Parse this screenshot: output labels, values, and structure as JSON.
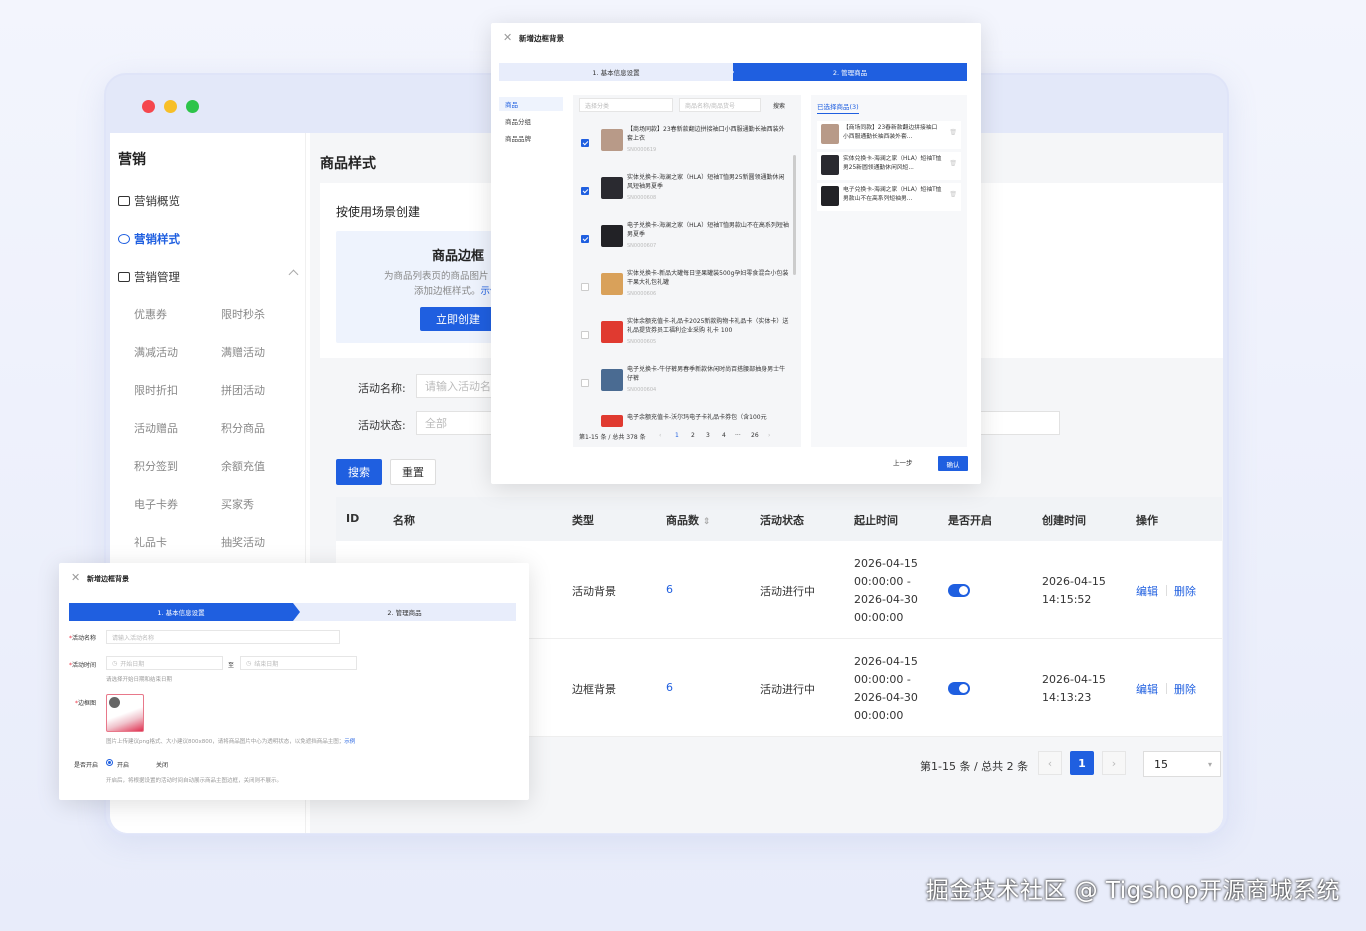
{
  "watermark": "掘金技术社区 @ Tigshop开源商城系统",
  "colors": {
    "accent": "#1f5fe0",
    "dot_red": "#f5474e",
    "dot_yellow": "#f7bf28",
    "dot_green": "#2dc44a"
  },
  "sidebar": {
    "title": "营销",
    "items": [
      {
        "label": "营销概览",
        "icon": "dashboard-icon"
      },
      {
        "label": "营销样式",
        "icon": "palette-icon"
      },
      {
        "label": "营销管理",
        "icon": "manage-icon"
      }
    ],
    "sub_items": [
      "优惠券",
      "限时秒杀",
      "满减活动",
      "满赠活动",
      "限时折扣",
      "拼团活动",
      "活动赠品",
      "积分商品",
      "积分签到",
      "余额充值",
      "电子卡券",
      "买家秀",
      "礼品卡",
      "抽奖活动"
    ]
  },
  "main": {
    "page_title": "商品样式",
    "scene_label": "按使用场景创建",
    "scene_card": {
      "title": "商品边框",
      "desc1": "为商品列表页的商品图片",
      "desc2": "添加边框样式。",
      "link": "示例",
      "button": "立即创建"
    },
    "filters": {
      "name_label": "活动名称:",
      "name_placeholder": "请输入活动名",
      "status_label": "活动状态:",
      "status_value": "全部"
    },
    "search_button": "搜索",
    "reset_button": "重置"
  },
  "table": {
    "headers": [
      "ID",
      "名称",
      "类型",
      "商品数",
      "活动状态",
      "起止时间",
      "是否开启",
      "创建时间",
      "操作"
    ],
    "rows": [
      {
        "type": "活动背景",
        "count": "6",
        "status": "活动进行中",
        "time1": "2026-04-15",
        "time2": "00:00:00 -",
        "time3": "2026-04-30",
        "time4": "00:00:00",
        "enabled": true,
        "created1": "2026-04-15",
        "created2": "14:15:52",
        "edit": "编辑",
        "delete": "删除"
      },
      {
        "type": "边框背景",
        "count": "6",
        "status": "活动进行中",
        "time1": "2026-04-15",
        "time2": "00:00:00 -",
        "time3": "2026-04-30",
        "time4": "00:00:00",
        "enabled": true,
        "created1": "2026-04-15",
        "created2": "14:13:23",
        "edit": "编辑",
        "delete": "删除"
      }
    ]
  },
  "pagination": {
    "info": "第1-15 条 / 总共 2 条",
    "current": "1",
    "page_size": "15"
  },
  "dialog_top": {
    "title": "新增边框背景",
    "step1": "1. 基本信息设置",
    "step2": "2. 管理商品",
    "left_menu": [
      "商品",
      "商品分组",
      "商品品牌"
    ],
    "category_placeholder": "选择分类",
    "keyword_placeholder": "商品名称/商品货号",
    "search": "搜索",
    "products": [
      {
        "name": "【商场同款】23春新款翻边拼接袖口小西服通勤长袖西装外套上衣",
        "code": "SN0000619",
        "checked": true,
        "color": "#b89a88"
      },
      {
        "name": "实体兑换卡-海澜之家（HLA）短袖T恤男25新圆领通勤休闲风短袖男夏季",
        "code": "SN0000608",
        "checked": true,
        "color": "#2a2a30"
      },
      {
        "name": "电子兑换卡-海澜之家（HLA）短袖T恤男款山不在高系列短袖男夏季",
        "code": "SN0000607",
        "checked": true,
        "color": "#222226"
      },
      {
        "name": "实体兑换卡-新品大罐每日坚果罐装500g孕妇零食混合小包装干果大礼包礼罐",
        "code": "SN0000606",
        "checked": false,
        "color": "#d9a15a"
      },
      {
        "name": "实体余额充值卡-礼品卡2025新款购物卡礼品卡（实体卡）送礼品提货券员工福利企业采购 礼卡 100",
        "code": "SN0000605",
        "checked": false,
        "color": "#e03a30"
      },
      {
        "name": "电子兑换卡-牛仔裤男春季新款休闲时尚百搭腰部抽身男士牛仔裤",
        "code": "SN0000604",
        "checked": false,
        "color": "#4a6b92"
      },
      {
        "name": "电子余额充值卡-沃尔玛电子卡礼品卡券包（含100元",
        "code": "",
        "checked": false,
        "color": "#e03a30"
      }
    ],
    "pager_info": "第1-15 条 / 总共 378 条",
    "pages": [
      "‹",
      "1",
      "2",
      "3",
      "4",
      "···",
      "26",
      "›"
    ],
    "selected_tab": "已选择商品(3)",
    "selected": [
      {
        "name": "【商场同款】23春新款翻边拼接袖口小西服通勤长袖西装外套...",
        "color": "#b89a88"
      },
      {
        "name": "实体兑换卡-海澜之家（HLA）短袖T恤男25新圆领通勤休闲风短...",
        "color": "#2a2a30"
      },
      {
        "name": "电子兑换卡-海澜之家（HLA）短袖T恤男款山不在高系列短袖男...",
        "color": "#222226"
      }
    ],
    "prev": "上一步",
    "ok": "确认"
  },
  "dialog_bottom": {
    "title": "新增边框背景",
    "step1": "1. 基本信息设置",
    "step2": "2. 管理商品",
    "name_label": "活动名称",
    "name_placeholder": "请输入活动名称",
    "time_label": "活动时间",
    "start_placeholder": "开始日期",
    "to": "至",
    "end_placeholder": "结束日期",
    "time_hint": "请选择开始日期和结束日期",
    "frame_label": "边框图",
    "frame_hint": "图片上传建议png格式、大小建议800x800，请将商品图片中心为透明状态，以免遮挡商品主图；",
    "frame_hint_link": "示例",
    "enable_label": "是否开启",
    "on": "开启",
    "off": "关闭",
    "enable_hint": "开启后，将根据设置的活动时间自动展示商品主图边框，关闭则不展示。"
  }
}
